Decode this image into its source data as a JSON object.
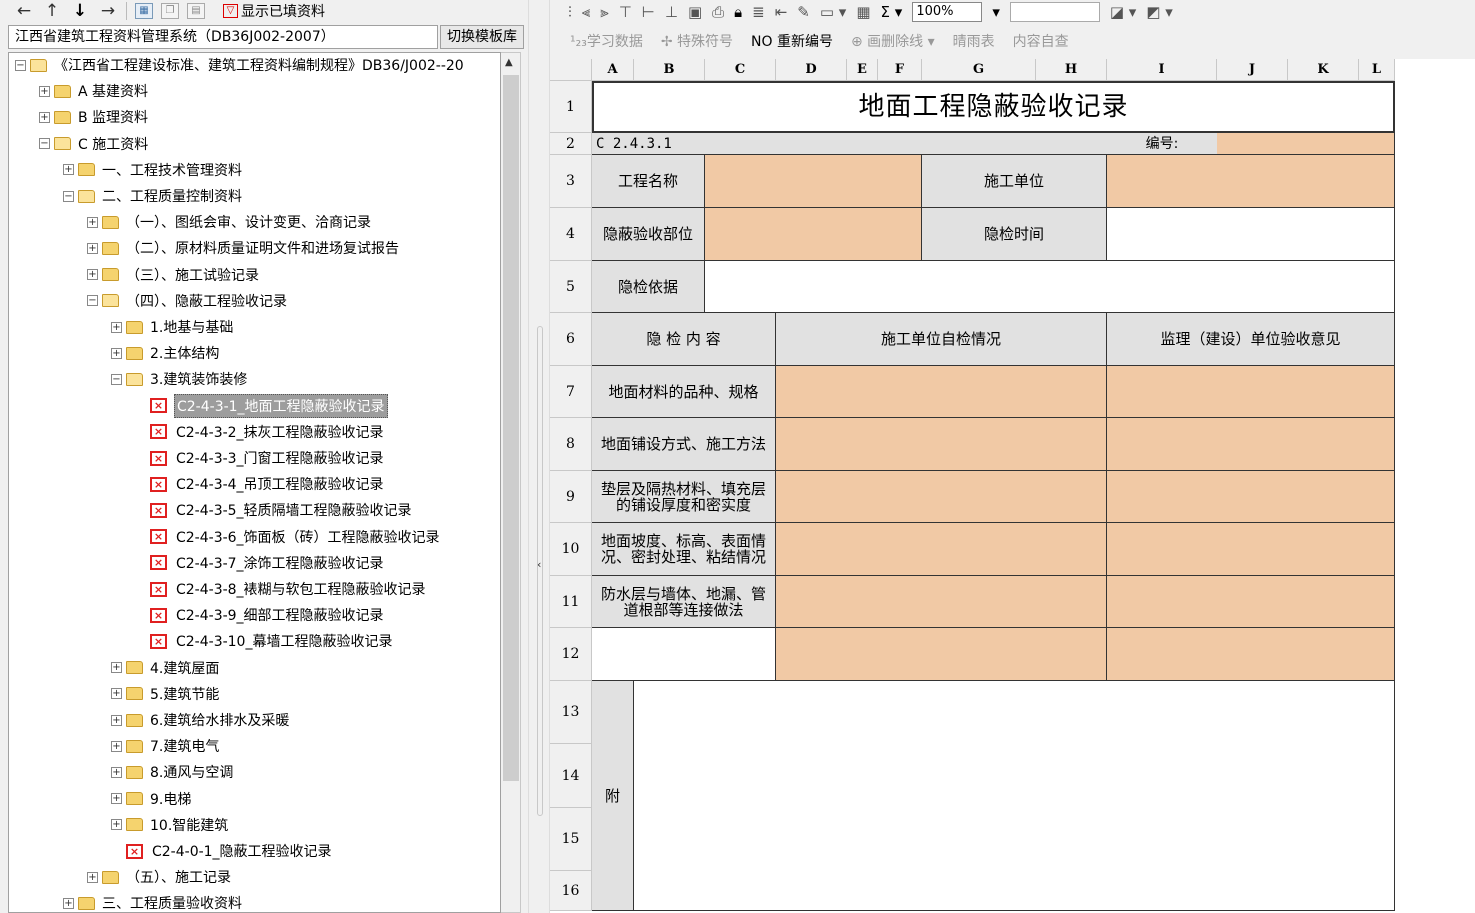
{
  "left_toolbar": {
    "show_filled_label": "显示已填资料"
  },
  "system": {
    "title": "江西省建筑工程资料管理系统（DB36J002-2007）",
    "switch_button": "切换模板库"
  },
  "tree": [
    {
      "label": "《江西省工程建设标准、建筑工程资料编制规程》DB36/J002--20",
      "indent": 0,
      "exp": "−",
      "icon": "folder-open"
    },
    {
      "label": "A 基建资料",
      "indent": 1,
      "exp": "+",
      "icon": "folder"
    },
    {
      "label": "B 监理资料",
      "indent": 1,
      "exp": "+",
      "icon": "folder"
    },
    {
      "label": "C 施工资料",
      "indent": 1,
      "exp": "−",
      "icon": "folder-open"
    },
    {
      "label": "一、工程技术管理资料",
      "indent": 2,
      "exp": "+",
      "icon": "folder"
    },
    {
      "label": "二、工程质量控制资料",
      "indent": 2,
      "exp": "−",
      "icon": "folder-open"
    },
    {
      "label": "（一）、图纸会审、设计变更、洽商记录",
      "indent": 3,
      "exp": "+",
      "icon": "folder"
    },
    {
      "label": "（二）、原材料质量证明文件和进场复试报告",
      "indent": 3,
      "exp": "+",
      "icon": "folder"
    },
    {
      "label": "（三）、施工试验记录",
      "indent": 3,
      "exp": "+",
      "icon": "folder"
    },
    {
      "label": "（四）、隐蔽工程验收记录",
      "indent": 3,
      "exp": "−",
      "icon": "folder-open"
    },
    {
      "label": "1.地基与基础",
      "indent": 4,
      "exp": "+",
      "icon": "folder"
    },
    {
      "label": "2.主体结构",
      "indent": 4,
      "exp": "+",
      "icon": "folder"
    },
    {
      "label": "3.建筑装饰装修",
      "indent": 4,
      "exp": "−",
      "icon": "folder-open"
    },
    {
      "label": "C2-4-3-1_地面工程隐蔽验收记录",
      "indent": 5,
      "exp": "",
      "icon": "doc",
      "selected": true
    },
    {
      "label": "C2-4-3-2_抹灰工程隐蔽验收记录",
      "indent": 5,
      "exp": "",
      "icon": "doc"
    },
    {
      "label": "C2-4-3-3_门窗工程隐蔽验收记录",
      "indent": 5,
      "exp": "",
      "icon": "doc"
    },
    {
      "label": "C2-4-3-4_吊顶工程隐蔽验收记录",
      "indent": 5,
      "exp": "",
      "icon": "doc"
    },
    {
      "label": "C2-4-3-5_轻质隔墙工程隐蔽验收记录",
      "indent": 5,
      "exp": "",
      "icon": "doc"
    },
    {
      "label": "C2-4-3-6_饰面板（砖）工程隐蔽验收记录",
      "indent": 5,
      "exp": "",
      "icon": "doc"
    },
    {
      "label": "C2-4-3-7_涂饰工程隐蔽验收记录",
      "indent": 5,
      "exp": "",
      "icon": "doc"
    },
    {
      "label": "C2-4-3-8_裱糊与软包工程隐蔽验收记录",
      "indent": 5,
      "exp": "",
      "icon": "doc"
    },
    {
      "label": "C2-4-3-9_细部工程隐蔽验收记录",
      "indent": 5,
      "exp": "",
      "icon": "doc"
    },
    {
      "label": "C2-4-3-10_幕墙工程隐蔽验收记录",
      "indent": 5,
      "exp": "",
      "icon": "doc"
    },
    {
      "label": "4.建筑屋面",
      "indent": 4,
      "exp": "+",
      "icon": "folder"
    },
    {
      "label": "5.建筑节能",
      "indent": 4,
      "exp": "+",
      "icon": "folder"
    },
    {
      "label": "6.建筑给水排水及采暖",
      "indent": 4,
      "exp": "+",
      "icon": "folder"
    },
    {
      "label": "7.建筑电气",
      "indent": 4,
      "exp": "+",
      "icon": "folder"
    },
    {
      "label": "8.通风与空调",
      "indent": 4,
      "exp": "+",
      "icon": "folder"
    },
    {
      "label": "9.电梯",
      "indent": 4,
      "exp": "+",
      "icon": "folder"
    },
    {
      "label": "10.智能建筑",
      "indent": 4,
      "exp": "+",
      "icon": "folder"
    },
    {
      "label": "C2-4-0-1_隐蔽工程验收记录",
      "indent": 4,
      "exp": "",
      "icon": "doc"
    },
    {
      "label": "（五）、施工记录",
      "indent": 3,
      "exp": "+",
      "icon": "folder"
    },
    {
      "label": "三、工程质量验收资料",
      "indent": 2,
      "exp": "+",
      "icon": "folder"
    }
  ],
  "right_toolbar": {
    "zoom": "100%",
    "items": [
      "¹₂₃学习数据",
      "✢ 特殊符号",
      "NO 重新编号",
      "⊕ 画删除线 ▾",
      "晴雨表",
      "内容自查"
    ],
    "active_index": 2
  },
  "sheet": {
    "columns": [
      "A",
      "B",
      "C",
      "D",
      "E",
      "F",
      "G",
      "H",
      "I",
      "J",
      "K",
      "L"
    ],
    "rows": [
      "1",
      "2",
      "3",
      "4",
      "5",
      "6",
      "7",
      "8",
      "9",
      "10",
      "11",
      "12",
      "13",
      "14",
      "15",
      "16"
    ],
    "title": "地面工程隐蔽验收记录",
    "code": "C 2.4.3.1",
    "number_label": "编号:",
    "project_name": "工程名称",
    "construction_unit": "施工单位",
    "hidden_part": "隐蔽验收部位",
    "inspection_time": "隐检时间",
    "inspection_basis": "隐检依据",
    "content_header": "隐  检  内  容",
    "self_check_header": "施工单位自检情况",
    "supervision_header": "监理（建设）单位验收意见",
    "items": [
      "地面材料的品种、规格",
      "地面铺设方式、施工方法",
      "垫层及隔热材料、填充层的铺设厚度和密实度",
      "地面坡度、标高、表面情况、密封处理、粘结情况",
      "防水层与墙体、地漏、管道根部等连接做法"
    ],
    "appendix_label": "附"
  },
  "colors": {
    "input_fill": "#f1c9a5",
    "label_fill": "#e1e1e1",
    "selection": "#9d9d9d",
    "doc_icon": "#e02020"
  }
}
